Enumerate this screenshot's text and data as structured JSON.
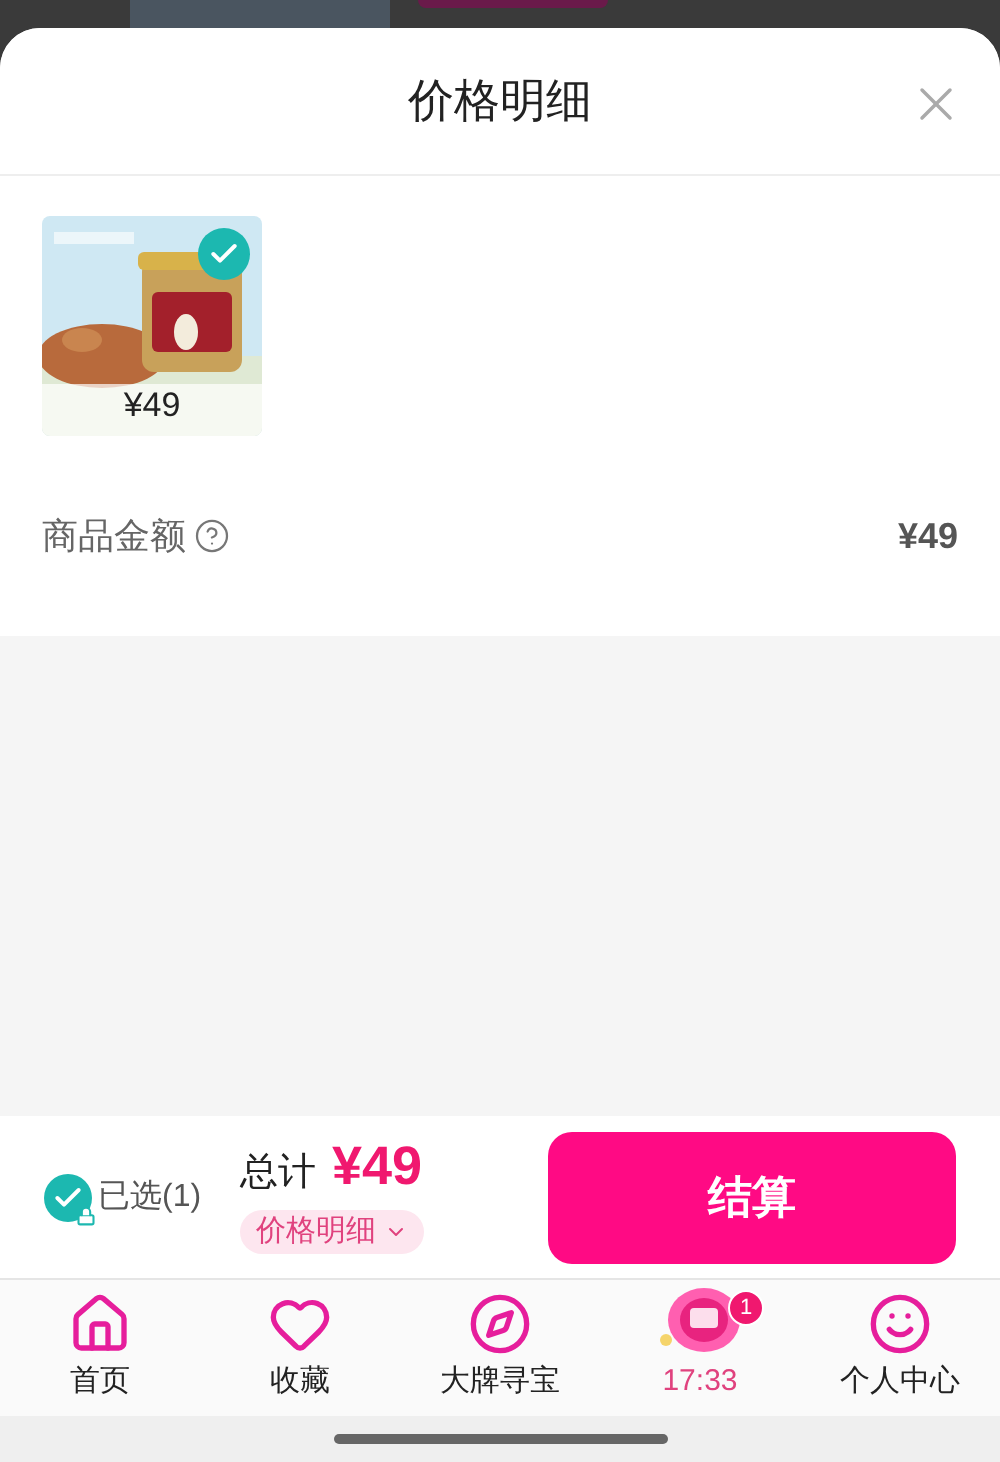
{
  "sheet": {
    "title": "价格明细"
  },
  "items": [
    {
      "kind": "picture",
      "price": "¥49",
      "checked": true
    }
  ],
  "summary": {
    "label": "商品金额",
    "amount": "¥49"
  },
  "footer": {
    "selected": {
      "label": "已选(1)",
      "checked": true
    },
    "total_label": "总计",
    "total": "¥49",
    "details_label": "价格明细",
    "checkout": "结算"
  },
  "tabs": [
    {
      "kind": "home",
      "label": "首页"
    },
    {
      "kind": "heart",
      "label": "收藏"
    },
    {
      "kind": "compass",
      "label": "大牌寻宝"
    },
    {
      "kind": "promo",
      "label": "17:33",
      "badge": "1"
    },
    {
      "kind": "face",
      "label": "个人中心"
    }
  ]
}
